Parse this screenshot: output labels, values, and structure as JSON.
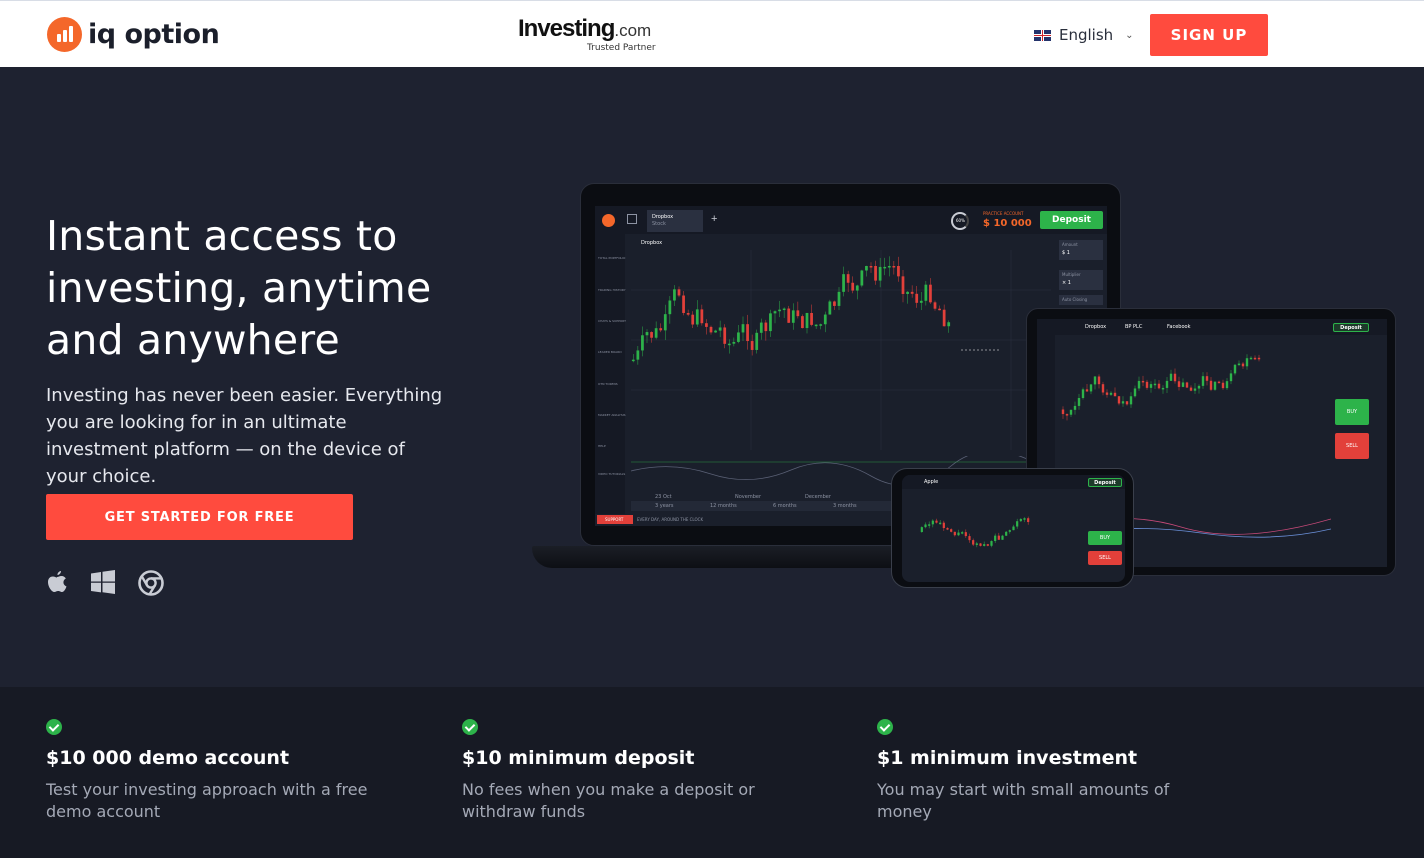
{
  "header": {
    "logo_text": "iq option",
    "partner_name": "Investing",
    "partner_suffix": ".com",
    "partner_tagline": "Trusted Partner",
    "language": "English",
    "signup_label": "SIGN UP"
  },
  "hero": {
    "title": "Instant access to investing, anytime and anywhere",
    "subtitle": "Investing has never been easier. Everything you are looking for in an ultimate investment platform — on the device of your choice.",
    "cta_label": "GET STARTED FOR FREE",
    "platform_icons": [
      "apple-icon",
      "windows-icon",
      "chrome-icon"
    ]
  },
  "devices": {
    "laptop": {
      "asset": "Dropbox",
      "asset_type": "Stock",
      "account_label": "PRACTICE ACCOUNT",
      "balance": "$ 10 000",
      "deposit_label": "Deposit",
      "progress": "60%",
      "amount_label": "Amount",
      "amount_value": "$ 1",
      "multiplier_label": "Multiplier",
      "multiplier_value": "× 1",
      "auto_closing_label": "Auto Closing",
      "support_label": "SUPPORT",
      "support_text": "EVERY DAY, AROUND THE CLOCK",
      "sidebar": [
        "TOTAL PORTFOLIO",
        "TRADING HISTORY",
        "CHATS & SUPPORT",
        "LEADER BOARD",
        "OTN TOKENS",
        "MARKET ANALYSIS",
        "HELP",
        "VIDEO TUTORIALS"
      ],
      "timeframes": [
        "3 years",
        "12 months",
        "6 months",
        "3 months"
      ],
      "months": [
        "23 Oct",
        "November",
        "December"
      ]
    },
    "tablet": {
      "tabs": [
        "Dropbox",
        "BP PLC",
        "Facebook"
      ],
      "deposit_label": "Deposit",
      "buy_label": "BUY",
      "sell_label": "SELL"
    },
    "phone": {
      "asset": "Apple",
      "deposit_label": "Deposit",
      "buy_label": "BUY",
      "sell_label": "SELL"
    }
  },
  "features": [
    {
      "title": "$10 000 demo account",
      "desc": "Test your investing approach with a free demo account"
    },
    {
      "title": "$10 minimum deposit",
      "desc": "No fees when you make a deposit or withdraw funds"
    },
    {
      "title": "$1 minimum investment",
      "desc": "You may start with small amounts of money"
    }
  ],
  "colors": {
    "accent": "#ff4b3e",
    "brand_orange": "#f4672a",
    "hero_bg": "#1e2230",
    "features_bg": "#171a24",
    "green": "#2db34a",
    "red": "#e2403a"
  }
}
